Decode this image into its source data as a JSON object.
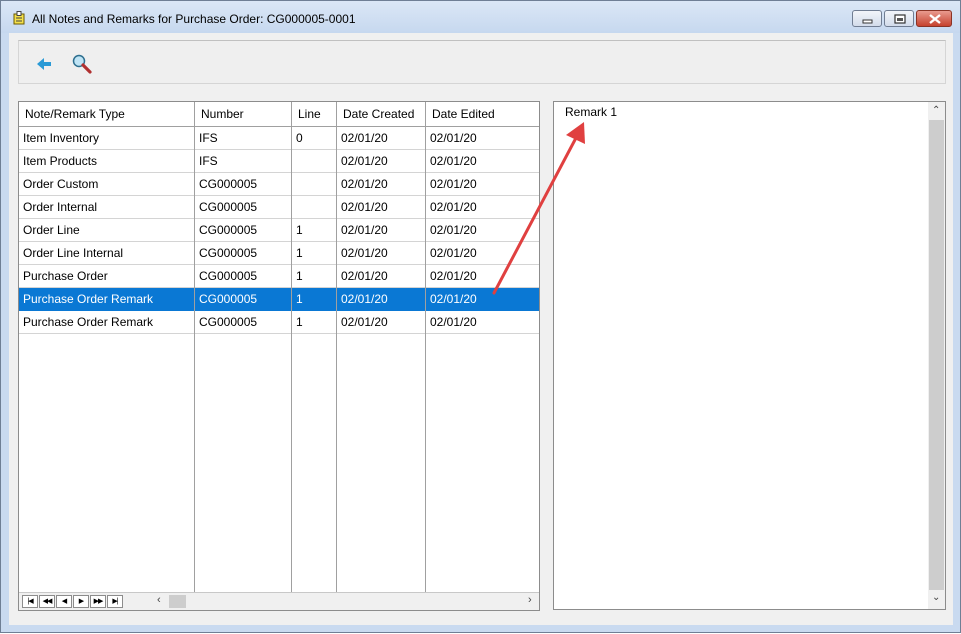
{
  "window": {
    "title": "All Notes and Remarks for Purchase Order:  CG000005-0001"
  },
  "toolbar": {
    "back_icon": "back-arrow-icon",
    "search_icon": "magnifier-icon"
  },
  "grid": {
    "columns": [
      "Note/Remark Type",
      "Number",
      "Line",
      "Date Created",
      "Date Edited"
    ],
    "rows": [
      [
        "Item Inventory",
        "IFS",
        "0",
        "02/01/20",
        "02/01/20"
      ],
      [
        "Item Products",
        "IFS",
        "",
        "02/01/20",
        "02/01/20"
      ],
      [
        "Order Custom",
        "CG000005",
        "",
        "02/01/20",
        "02/01/20"
      ],
      [
        "Order Internal",
        "CG000005",
        "",
        "02/01/20",
        "02/01/20"
      ],
      [
        "Order Line",
        "CG000005",
        "1",
        "02/01/20",
        "02/01/20"
      ],
      [
        "Order Line Internal",
        "CG000005",
        "1",
        "02/01/20",
        "02/01/20"
      ],
      [
        "Purchase Order",
        "CG000005",
        "1",
        "02/01/20",
        "02/01/20"
      ],
      [
        "Purchase Order Remark",
        "CG000005",
        "1",
        "02/01/20",
        "02/01/20"
      ],
      [
        "Purchase Order Remark",
        "CG000005",
        "1",
        "02/01/20",
        "02/01/20"
      ]
    ],
    "selected_row": 7,
    "nav_buttons": [
      "|◀",
      "◀◀",
      "◀",
      "▶",
      "▶▶",
      "▶|"
    ]
  },
  "memo": {
    "text": "Remark 1"
  },
  "colors": {
    "selection": "#0a78d4",
    "annotation_arrow": "#e04040",
    "title_bg": "#c6d8ef"
  }
}
